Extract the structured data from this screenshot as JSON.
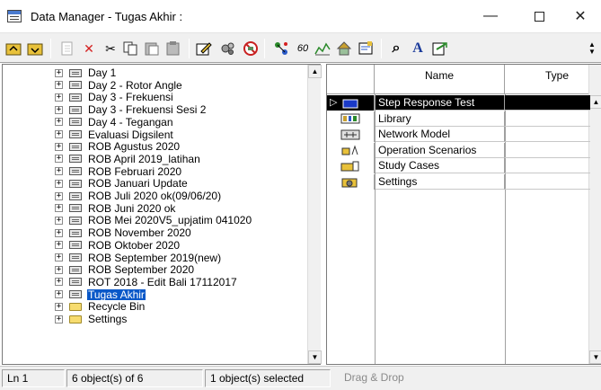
{
  "window": {
    "title": "Data Manager - Tugas Akhir :",
    "minimize_glyph": "—",
    "close_glyph": "✕"
  },
  "toolbar": {
    "icons": [
      "up-folder-icon",
      "folder-up-icon",
      "new-object-icon",
      "delete-icon",
      "cut-icon",
      "copy-icon",
      "paste-icon",
      "paste-special-icon",
      "edit-object-icon",
      "settings-icon",
      "no-entry-icon",
      "network-icon",
      "link-icon",
      "graphic-icon",
      "house-icon",
      "notes-icon",
      "find-icon",
      "font-icon",
      "export-icon"
    ],
    "delete_glyph": "✕",
    "cut_glyph": "✂",
    "find_glyph": "⌕",
    "font_glyph": "A",
    "link_glyph": "60"
  },
  "tree": {
    "expand_glyph": "+",
    "items": [
      {
        "label": "Day 1",
        "icon": "project-icon"
      },
      {
        "label": "Day 2 - Rotor Angle",
        "icon": "project-icon"
      },
      {
        "label": "Day 3 - Frekuensi",
        "icon": "project-icon"
      },
      {
        "label": "Day 3 - Frekuensi Sesi 2",
        "icon": "project-icon"
      },
      {
        "label": "Day 4 - Tegangan",
        "icon": "project-icon"
      },
      {
        "label": "Evaluasi Digsilent",
        "icon": "project-icon"
      },
      {
        "label": "ROB Agustus 2020",
        "icon": "project-icon"
      },
      {
        "label": "ROB April 2019_latihan",
        "icon": "project-icon"
      },
      {
        "label": "ROB Februari 2020",
        "icon": "project-icon"
      },
      {
        "label": "ROB Januari Update",
        "icon": "project-icon"
      },
      {
        "label": "ROB Juli 2020 ok(09/06/20)",
        "icon": "project-icon"
      },
      {
        "label": "ROB Juni 2020 ok",
        "icon": "project-icon"
      },
      {
        "label": "ROB Mei 2020V5_upjatim 041020",
        "icon": "project-icon"
      },
      {
        "label": "ROB November 2020",
        "icon": "project-icon"
      },
      {
        "label": "ROB Oktober 2020",
        "icon": "project-icon"
      },
      {
        "label": "ROB September 2019(new)",
        "icon": "project-icon"
      },
      {
        "label": "ROB September 2020",
        "icon": "project-icon"
      },
      {
        "label": "ROT 2018 - Edit Bali 17112017",
        "icon": "project-icon"
      },
      {
        "label": "Tugas Akhir",
        "icon": "project-icon",
        "selected": true
      },
      {
        "label": "Recycle Bin",
        "icon": "folder-icon"
      },
      {
        "label": "Settings",
        "icon": "folder-icon"
      }
    ],
    "scroll_up_glyph": "▲",
    "scroll_down_glyph": "▼"
  },
  "list": {
    "columns": {
      "name": "Name",
      "type": "Type"
    },
    "rows": [
      {
        "name": "Step Response Test",
        "icon": "folder-icon",
        "selected": true,
        "marker": "▷"
      },
      {
        "name": "Library",
        "icon": "library-icon"
      },
      {
        "name": "Network Model",
        "icon": "network-model-icon"
      },
      {
        "name": "Operation Scenarios",
        "icon": "operation-scenarios-icon"
      },
      {
        "name": "Study Cases",
        "icon": "study-cases-icon"
      },
      {
        "name": "Settings",
        "icon": "settings-folder-icon"
      }
    ],
    "scroll_up_glyph": "▲",
    "scroll_down_glyph": "▼"
  },
  "status": {
    "line": "Ln 1",
    "objects": "6 object(s) of 6",
    "selected": "1 object(s) selected",
    "mode": "Drag & Drop"
  },
  "colors": {
    "selection_tree": "#0a58c8",
    "selection_list": "#000000",
    "toolbar_bg": "#f0f0f0"
  }
}
